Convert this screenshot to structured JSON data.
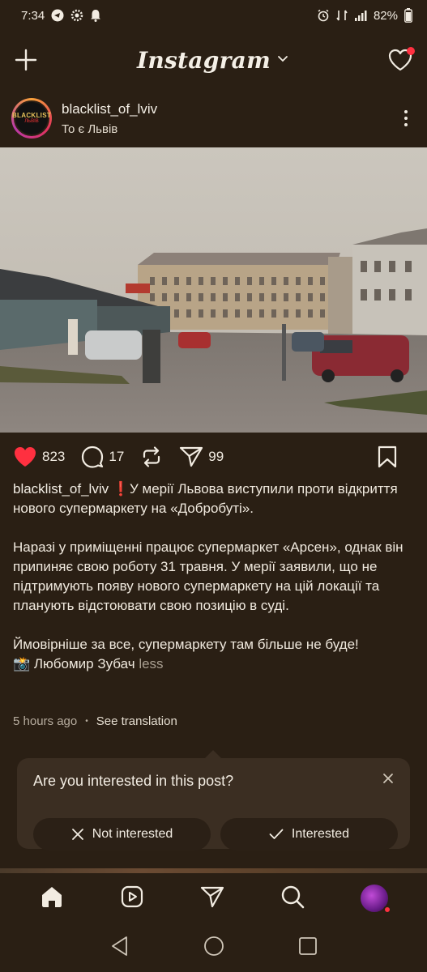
{
  "status_bar": {
    "time": "7:34",
    "battery": "82%"
  },
  "top_bar": {
    "logo": "Instagram"
  },
  "post": {
    "username": "blacklist_of_lviv",
    "location": "То є Львів",
    "avatar_text_top": "BLACKLIST",
    "avatar_text_bottom": "ЛЬВІВ",
    "likes": "823",
    "comments": "17",
    "shares": "99",
    "caption_user": "blacklist_of_lviv",
    "caption_lead": "❗У мерії Львова виступили проти відкриття нового супермаркету на «Добробуті».",
    "caption_p2": "Наразі у приміщенні працює супермаркет «Арсен», однак він припиняє свою роботу 31 травня. У мерії заявили, що не підтримують появу нового супермаркету на цій локації та планують відстоювати свою позицію в суді.",
    "caption_p3": "Ймовірніше за все, супермаркету там більше не буде!",
    "caption_credit": "📸 Любомир Зубач",
    "less_label": "less",
    "time_ago": "5 hours ago",
    "see_translation": "See translation"
  },
  "interest_card": {
    "title": "Are you interested in this post?",
    "not_interested": "Not interested",
    "interested": "Interested"
  },
  "icons": {
    "heart_color": "#ff3040",
    "notification_dot": "#ff3040"
  }
}
